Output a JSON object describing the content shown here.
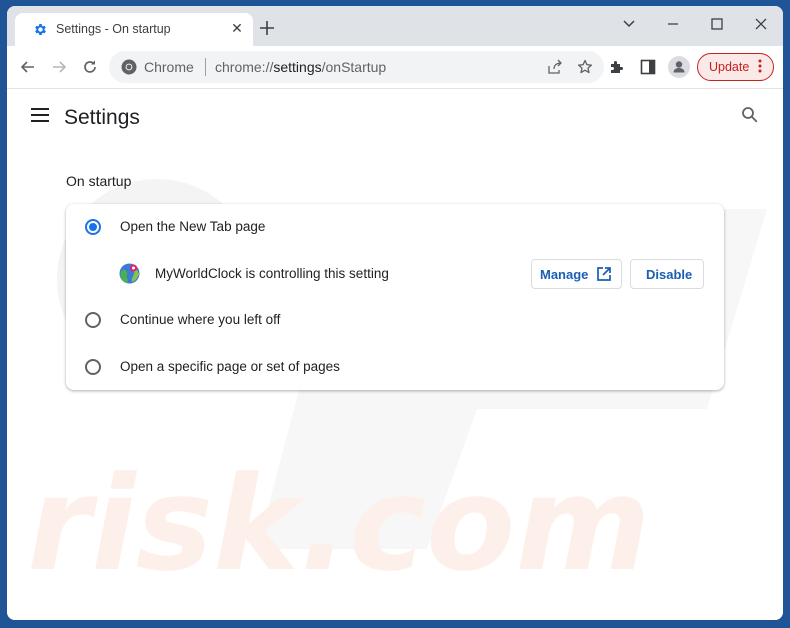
{
  "browser": {
    "tab": {
      "title": "Settings - On startup",
      "favicon": "settings-gear-icon",
      "close_icon": "close-icon"
    },
    "new_tab_icon": "plus-icon",
    "window_controls": [
      "tab-search-chevron",
      "minimize",
      "maximize",
      "close"
    ],
    "toolbar": {
      "back_icon": "arrow-left-icon",
      "forward_icon": "arrow-right-icon",
      "reload_icon": "reload-icon",
      "omnibox": {
        "site_chip": "Chrome",
        "url_prefix": "chrome://",
        "url_host": "settings",
        "url_path": "/onStartup"
      },
      "update_label": "Update"
    }
  },
  "settings": {
    "page_title": "Settings",
    "section_title": "On startup",
    "options": [
      {
        "label": "Open the New Tab page",
        "checked": true
      },
      {
        "label": "Continue where you left off",
        "checked": false
      },
      {
        "label": "Open a specific page or set of pages",
        "checked": false
      }
    ],
    "extension_notice": {
      "text": "MyWorldClock is controlling this setting",
      "manage_label": "Manage",
      "disable_label": "Disable"
    }
  },
  "watermark": "PCrisk.com",
  "colors": {
    "accent": "#1a73e8",
    "update": "#c5221f",
    "desktop": "#1f5596"
  }
}
